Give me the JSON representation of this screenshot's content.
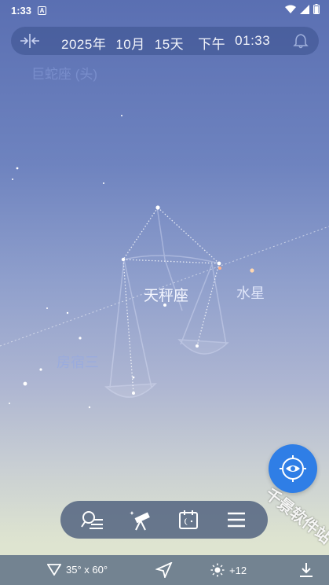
{
  "status_bar": {
    "time": "1:33",
    "notification_letter": "A"
  },
  "date_bar": {
    "year": "2025年",
    "month": "10月",
    "day": "15天",
    "ampm": "下午",
    "time": "01:33"
  },
  "sky_labels": {
    "serpens": "巨蛇座 (头)",
    "libra": "天秤座",
    "mercury": "水星",
    "fangsu": "房宿三"
  },
  "toolbar": {
    "items": [
      {
        "icon": "search-list-icon"
      },
      {
        "icon": "telescope-icon"
      },
      {
        "icon": "calendar-night-icon"
      },
      {
        "icon": "menu-icon"
      }
    ]
  },
  "bottom_bar": {
    "fov": "35° x 60°",
    "brightness": "+12"
  },
  "watermark": "千景软件站",
  "colors": {
    "accent": "#2f7ee6",
    "sky_top": "#5a6fb2",
    "sky_bottom": "#e3e7cf"
  }
}
